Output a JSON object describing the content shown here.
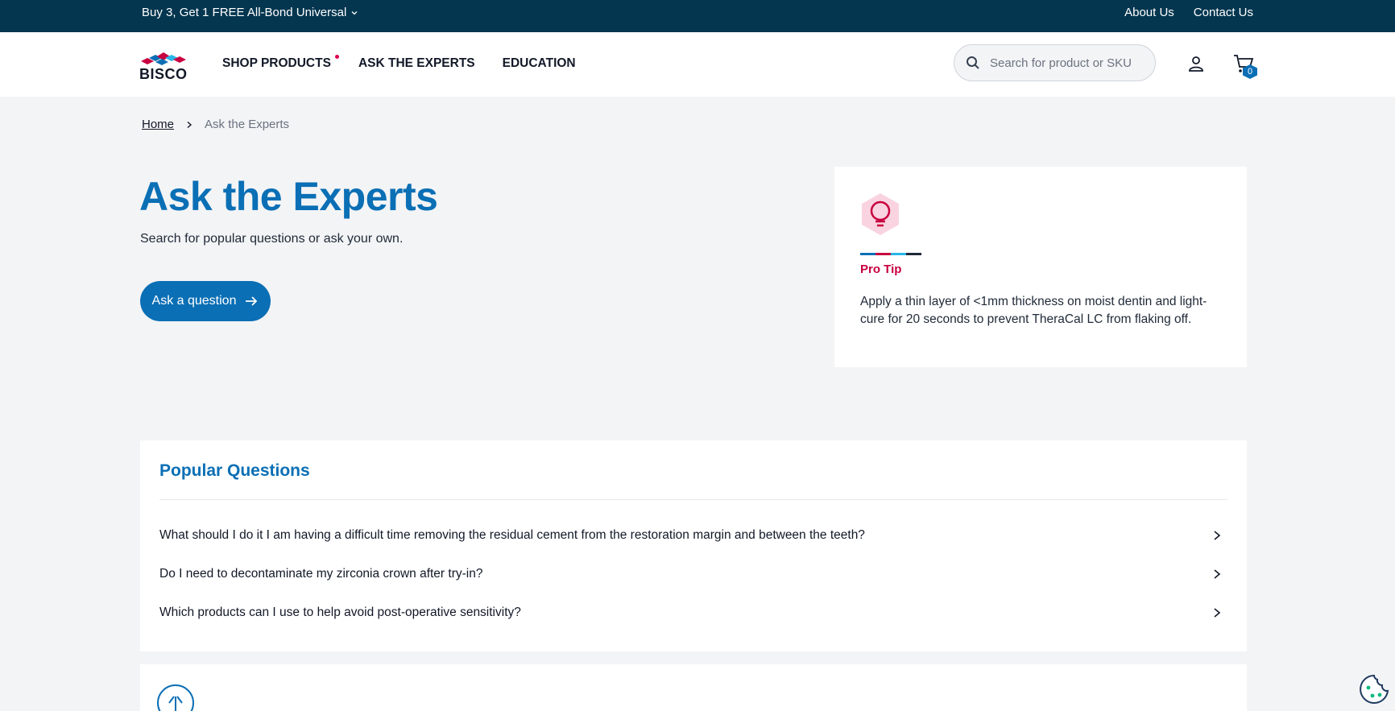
{
  "promo": {
    "text": "Buy 3, Get 1 FREE All-Bond Universal",
    "links": [
      "About Us",
      "Contact Us"
    ]
  },
  "header": {
    "logo_text": "BISCO",
    "nav": [
      "SHOP PRODUCTS",
      "ASK THE EXPERTS",
      "EDUCATION"
    ],
    "search_placeholder": "Search for product or SKU",
    "cart_count": "0"
  },
  "breadcrumb": {
    "home": "Home",
    "current": "Ask the Experts"
  },
  "hero": {
    "title": "Ask the Experts",
    "subtitle": "Search for popular questions or ask your own.",
    "button": "Ask a question"
  },
  "tip": {
    "label": "Pro Tip",
    "text": "Apply a thin layer of <1mm thickness on moist dentin and light-cure for 20 seconds to prevent TheraCal LC from flaking off.",
    "colors": [
      "#0a6fb5",
      "#c8003f",
      "#29b6e8",
      "#1f2937"
    ]
  },
  "popular": {
    "title": "Popular Questions",
    "questions": [
      "What should I do it I am having a difficult time removing the residual cement from the restoration margin and between the teeth?",
      "Do I need to decontaminate my zirconia crown after try-in?",
      "Which products can I use to help avoid post-operative sensitivity?"
    ]
  },
  "colors": {
    "brand_blue": "#0a6fb5",
    "promo_bg": "#04364f",
    "accent_red": "#c8003f"
  }
}
